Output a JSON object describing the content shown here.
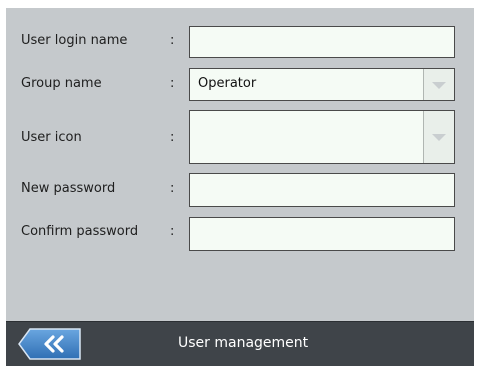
{
  "form": {
    "user_login_name": {
      "label": "User login name",
      "value": ""
    },
    "group_name": {
      "label": "Group name",
      "value": "Operator"
    },
    "user_icon": {
      "label": "User icon",
      "value": ""
    },
    "new_password": {
      "label": "New password",
      "value": ""
    },
    "confirm_password": {
      "label": "Confirm password",
      "value": ""
    },
    "separator": ":"
  },
  "footer": {
    "title": "User management",
    "back_icon": "double-chevron-left-icon"
  },
  "colors": {
    "background": "#c5c9cc",
    "footer": "#3f4449",
    "back_button": "#4a88c8",
    "field": "#f5fbf5"
  }
}
